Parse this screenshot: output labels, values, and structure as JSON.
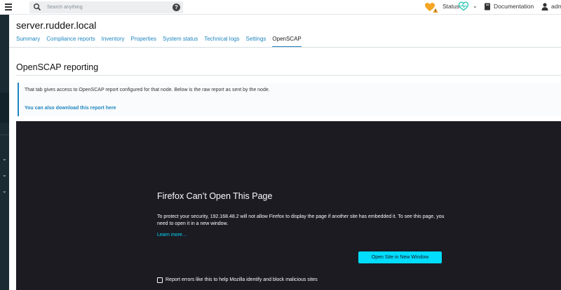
{
  "topbar": {
    "search_placeholder": "Search anything",
    "help_symbol": "?",
    "status_label": "Status",
    "documentation_label": "Documentation",
    "user_label": "adm",
    "colors": {
      "warning": "#f5a623",
      "health": "#2ec4b6"
    }
  },
  "node": {
    "title": "server.rudder.local"
  },
  "tabs": [
    {
      "label": "Summary"
    },
    {
      "label": "Compliance reports"
    },
    {
      "label": "Inventory"
    },
    {
      "label": "Properties"
    },
    {
      "label": "System status"
    },
    {
      "label": "Technical logs"
    },
    {
      "label": "Settings"
    },
    {
      "label": "OpenSCAP"
    }
  ],
  "section": {
    "title": "OpenSCAP reporting",
    "info_text": "That tab gives access to OpenSCAP report configured for that node. Below is the raw report as sent by the node.",
    "download_link": "You can also download this report here"
  },
  "frame": {
    "title": "Firefox Can’t Open This Page",
    "message": "To protect your security, 192.168.48.2 will not allow Firefox to display the page if another site has embedded it. To see this page, you need to open it in a new window.",
    "learn_more": "Learn more…",
    "open_button": "Open Site in New Window",
    "report_checkbox_label": "Report errors like this to help Mozilla identify and block malicious sites"
  }
}
